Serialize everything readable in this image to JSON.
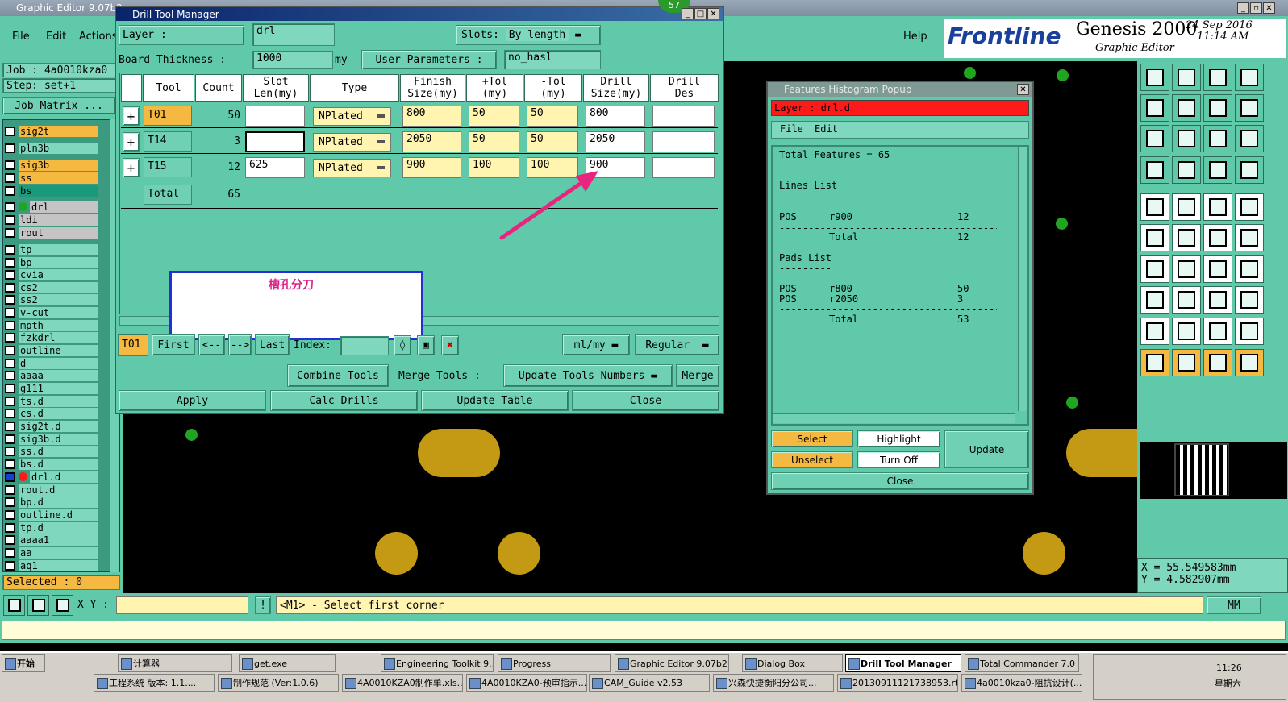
{
  "main": {
    "title": "Graphic Editor 9.07b2",
    "menu": [
      "File",
      "Edit",
      "Actions"
    ],
    "job": "Job : 4a0010kza0",
    "step": "Step: set+1",
    "job_matrix": "Job Matrix ...",
    "help": "Help",
    "brand": "Frontline",
    "product": "Genesis 2000",
    "subtitle": "Graphic Editor",
    "date": "24 Sep 2016",
    "time": "11:14 AM",
    "selected": "Selected : 0",
    "xy_label": "X Y :",
    "status_msg": "<M1> - Select first corner",
    "units": "MM",
    "coord_x": "X = 55.549583mm",
    "coord_y": "Y = 4.582907mm",
    "badge": "57"
  },
  "layers": [
    {
      "name": "sig2t",
      "color": "#f5b942"
    },
    {
      "name": "pln3b",
      "color": "#7fd8bd"
    },
    {
      "name": "sig3b",
      "color": "#f5b942"
    },
    {
      "name": "ss",
      "color": "#f5b942"
    },
    {
      "name": "bs",
      "color": "#1a9a7a"
    },
    {
      "name": "drl",
      "color": "#c4c4c4"
    },
    {
      "name": "ldi",
      "color": "#c4c4c4"
    },
    {
      "name": "rout",
      "color": "#c4c4c4"
    },
    {
      "name": "tp",
      "color": "#7fd8bd"
    },
    {
      "name": "bp",
      "color": "#7fd8bd"
    },
    {
      "name": "cvia",
      "color": "#7fd8bd"
    },
    {
      "name": "cs2",
      "color": "#7fd8bd"
    },
    {
      "name": "ss2",
      "color": "#7fd8bd"
    },
    {
      "name": "v-cut",
      "color": "#7fd8bd"
    },
    {
      "name": "mpth",
      "color": "#7fd8bd"
    },
    {
      "name": "fzkdrl",
      "color": "#7fd8bd"
    },
    {
      "name": "outline",
      "color": "#7fd8bd"
    },
    {
      "name": "d",
      "color": "#7fd8bd"
    },
    {
      "name": "aaaa",
      "color": "#7fd8bd"
    },
    {
      "name": "g111",
      "color": "#7fd8bd"
    },
    {
      "name": "ts.d",
      "color": "#7fd8bd"
    },
    {
      "name": "cs.d",
      "color": "#7fd8bd"
    },
    {
      "name": "sig2t.d",
      "color": "#7fd8bd"
    },
    {
      "name": "sig3b.d",
      "color": "#7fd8bd"
    },
    {
      "name": "ss.d",
      "color": "#7fd8bd"
    },
    {
      "name": "bs.d",
      "color": "#7fd8bd"
    },
    {
      "name": "drl.d",
      "color": "#7fd8bd"
    },
    {
      "name": "rout.d",
      "color": "#7fd8bd"
    },
    {
      "name": "bp.d",
      "color": "#7fd8bd"
    },
    {
      "name": "outline.d",
      "color": "#7fd8bd"
    },
    {
      "name": "tp.d",
      "color": "#7fd8bd"
    },
    {
      "name": "aaaa1",
      "color": "#7fd8bd"
    },
    {
      "name": "aa",
      "color": "#7fd8bd"
    },
    {
      "name": "aq1",
      "color": "#7fd8bd"
    }
  ],
  "dtm": {
    "title": "Drill Tool Manager",
    "layer_label": "Layer :",
    "layer_value": "drl",
    "slots_label": "Slots:",
    "slots_value": "By length",
    "board_label": "Board Thickness :",
    "board_value": "1000",
    "board_unit": "my",
    "user_params": "User Parameters :",
    "user_params_value": "no_hasl",
    "headers": [
      "Tool",
      "Count",
      "Slot\nLen(my)",
      "Type",
      "Finish\nSize(my)",
      "+Tol\n(my)",
      "-Tol\n(my)",
      "Drill\nSize(my)",
      "Drill\nDes"
    ],
    "rows": [
      {
        "tool": "T01",
        "count": "50",
        "slot": "",
        "type": "NPlated",
        "finish": "800",
        "ptol": "50",
        "mtol": "50",
        "drill": "800",
        "des": ""
      },
      {
        "tool": "T14",
        "count": "3",
        "slot": "",
        "type": "NPlated",
        "finish": "2050",
        "ptol": "50",
        "mtol": "50",
        "drill": "2050",
        "des": ""
      },
      {
        "tool": "T15",
        "count": "12",
        "slot": "625",
        "type": "NPlated",
        "finish": "900",
        "ptol": "100",
        "mtol": "100",
        "drill": "900",
        "des": ""
      }
    ],
    "total_label": "Total",
    "total_count": "65",
    "annotation": "槽孔分刀",
    "current_tool": "T01",
    "nav": [
      "First",
      "<--",
      "-->",
      "Last"
    ],
    "index_label": "Index:",
    "units_sel": "ml/my",
    "mode_sel": "Regular",
    "combine": "Combine Tools",
    "merge_tools": "Merge Tools :",
    "update_numbers": "Update Tools Numbers",
    "merge": "Merge",
    "apply": "Apply",
    "calc": "Calc Drills",
    "update_table": "Update Table",
    "close": "Close"
  },
  "fhp": {
    "title": "Features Histogram Popup",
    "layer": "Layer : drl.d",
    "menu": [
      "File",
      "Edit"
    ],
    "lines": [
      {
        "c1": "Total Features = 65",
        "c2": "",
        "c3": ""
      },
      {
        "c1": "",
        "c2": "",
        "c3": ""
      },
      {
        "c1": "Lines List",
        "c2": "",
        "c3": ""
      },
      {
        "c1": "----------",
        "c2": "",
        "c3": ""
      },
      {
        "c1": "POS",
        "c2": "r900",
        "c3": "12"
      },
      {
        "c1": "---------------------------------------",
        "c2": "",
        "c3": ""
      },
      {
        "c1": "",
        "c2": "Total",
        "c3": "12"
      },
      {
        "c1": "Pads List",
        "c2": "",
        "c3": ""
      },
      {
        "c1": "---------",
        "c2": "",
        "c3": ""
      },
      {
        "c1": "POS",
        "c2": "r800",
        "c3": "50"
      },
      {
        "c1": "POS",
        "c2": "r2050",
        "c3": "3"
      },
      {
        "c1": "---------------------------------------",
        "c2": "",
        "c3": ""
      },
      {
        "c1": "",
        "c2": "Total",
        "c3": "53"
      }
    ],
    "select": "Select",
    "unselect": "Unselect",
    "highlight": "Highlight",
    "turnoff": "Turn Off",
    "update": "Update",
    "close": "Close"
  },
  "taskbar": {
    "start": "开始",
    "row1": [
      "计算器",
      "get.exe",
      "Engineering Toolkit 9....",
      "Progress",
      "Graphic Editor 9.07b2 ...",
      "Dialog Box",
      "Drill Tool Manager",
      "Total Commander 7.0 ..."
    ],
    "row2": [
      "工程系统 版本: 1.1....",
      "制作规范 (Ver:1.0.6)",
      "4A0010KZA0制作单.xls...",
      "4A0010KZA0-预审指示...",
      "CAM_Guide v2.53",
      "兴森快捷衡阳分公司...",
      "20130911121738953.rt...",
      "4a0010kza0-阻抗设计(..."
    ],
    "clock": "11:26",
    "day": "星期六"
  }
}
